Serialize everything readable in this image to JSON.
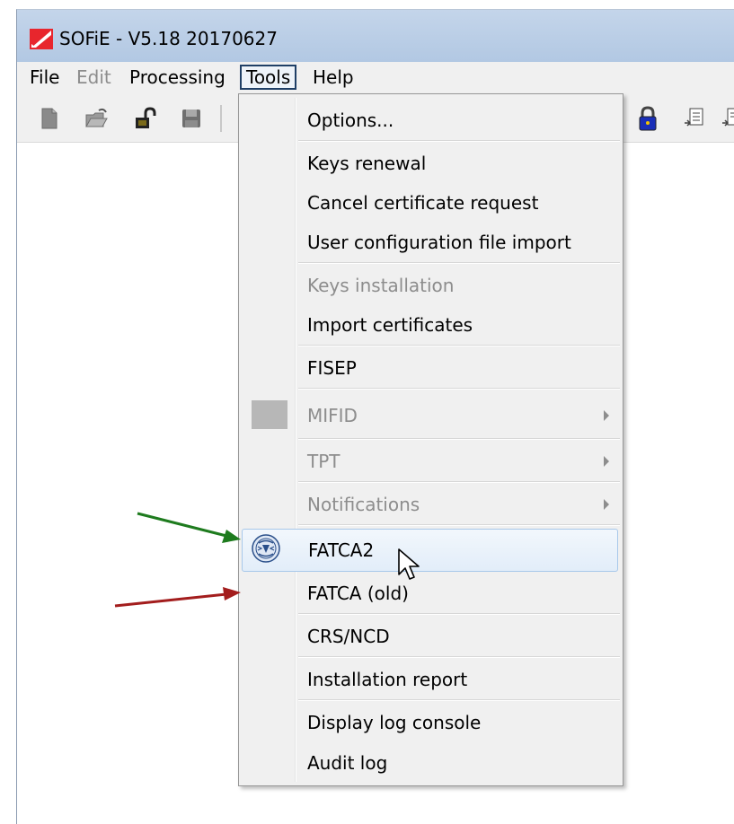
{
  "window": {
    "title": "SOFiE - V5.18 20170627"
  },
  "menubar": {
    "items": [
      {
        "label": "File",
        "state": "enabled"
      },
      {
        "label": "Edit",
        "state": "disabled"
      },
      {
        "label": "Processing",
        "state": "enabled"
      },
      {
        "label": "Tools",
        "state": "open"
      },
      {
        "label": "Help",
        "state": "enabled"
      }
    ]
  },
  "toolbar": {
    "icons": [
      "new-file-icon",
      "open-folder-icon",
      "unlock-icon",
      "save-icon",
      "lock-icon",
      "document-icon",
      "document-icon"
    ]
  },
  "tools_menu": {
    "items": [
      {
        "label": "Options...",
        "state": "enabled"
      },
      {
        "label": "Keys renewal",
        "state": "enabled"
      },
      {
        "label": "Cancel certificate request",
        "state": "enabled"
      },
      {
        "label": "User configuration file import",
        "state": "enabled"
      },
      {
        "label": "Keys installation",
        "state": "disabled"
      },
      {
        "label": "Import certificates",
        "state": "enabled"
      },
      {
        "label": "FISEP",
        "state": "enabled"
      },
      {
        "label": "MIFID",
        "state": "disabled",
        "submenu": true,
        "icon": "mifid-icon"
      },
      {
        "label": "TPT",
        "state": "disabled",
        "submenu": true
      },
      {
        "label": "Notifications",
        "state": "disabled",
        "submenu": true
      },
      {
        "label": "FATCA2",
        "state": "hover",
        "icon": "irs-seal-icon"
      },
      {
        "label": "FATCA (old)",
        "state": "enabled"
      },
      {
        "label": "CRS/NCD",
        "state": "enabled"
      },
      {
        "label": "Installation report",
        "state": "enabled"
      },
      {
        "label": "Display log console",
        "state": "enabled"
      },
      {
        "label": "Audit log",
        "state": "enabled"
      }
    ]
  },
  "annotations": {
    "green_arrow": {
      "color": "#1e7b1e",
      "points_to": "FATCA2"
    },
    "red_arrow": {
      "color": "#a31d1d",
      "points_to": "FATCA (old)"
    }
  },
  "colors": {
    "title_bar": "#b9cde6",
    "menu_background": "#f0f0f0",
    "hover_border": "#a8c8ea",
    "disabled_text": "#8d8d8d"
  }
}
